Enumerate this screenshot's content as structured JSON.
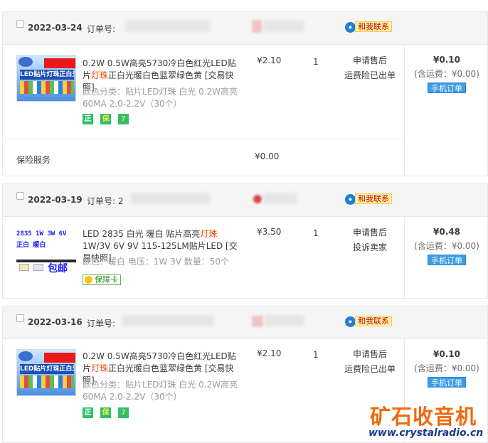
{
  "orders": [
    {
      "date": "2022-03-24",
      "order_label": "订单号:",
      "contact": "和我联系",
      "item": {
        "title_a": "0.2W 0.5W高亮5730冷白色红光LED贴片",
        "title_hl": "灯珠",
        "title_b": "正白光暖白色蓝翠绿色黄 [交易快照]",
        "attr": "颜色分类：贴片LED灯珠 白光 0.2W高亮60MA 2.0-2.2V（30个）",
        "price": "¥2.10",
        "qty": "1",
        "service_1": "申请售后",
        "service_2": "运费险已出单",
        "badges": [
          "正",
          "保",
          "7"
        ]
      },
      "total": "¥0.10",
      "shipping": "(含运费：¥0.00)",
      "mobile_order": "手机订单",
      "insurance_label": "保险服务",
      "insurance_price": "¥0.00"
    },
    {
      "date": "2022-03-19",
      "order_label": "订单号: 2",
      "contact": "和我联系",
      "item": {
        "title_a": "LED 2835 白光 暖白 贴片高亮",
        "title_hl": "灯珠",
        "title_b": " 1W/3V 6V 9V 115-125LM贴片LED [交易快照]",
        "attr": "颜色：暖白  电压：1W 3V  数量：50个",
        "price": "¥3.50",
        "qty": "1",
        "service_1": "申请售后",
        "service_2": "投诉卖家",
        "guarantee": "保障卡",
        "thumb_text": "2835 1W 3W 6V\n正白 暖白",
        "thumb_baoyou": "包邮"
      },
      "total": "¥0.48",
      "shipping": "(含运费：¥0.00)",
      "mobile_order": "手机订单"
    },
    {
      "date": "2022-03-16",
      "order_label": "订单号:",
      "contact": "和我联系",
      "item": {
        "title_a": "0.2W 0.5W高亮5730冷白色红光LED贴片",
        "title_hl": "灯珠",
        "title_b": "正白光暖白色蓝翠绿色黄 [交易快照]",
        "attr": "颜色分类：贴片LED灯珠 白光 0.2W高亮60MA 2.0-2.2V（30个）",
        "price": "¥2.10",
        "qty": "1",
        "service_1": "申请售后",
        "service_2": "运费险已出单",
        "badges": [
          "正",
          "保",
          "7"
        ]
      },
      "total": "¥0.10",
      "shipping": "(含运费：¥0.00)",
      "mobile_order": "手机订单"
    }
  ],
  "product_thumb": {
    "top_banner": "LED贴片灯珠正白光"
  },
  "watermark": {
    "brand": "矿石收音机",
    "url": "www.crystalradio.cn"
  },
  "colors": {
    "header_bg": "#f5f5f5",
    "highlight": "#ff4400",
    "watermark_orange": "#f2690e",
    "watermark_blue": "#1b3a8c",
    "mobile_button": "#3c9ce6"
  }
}
